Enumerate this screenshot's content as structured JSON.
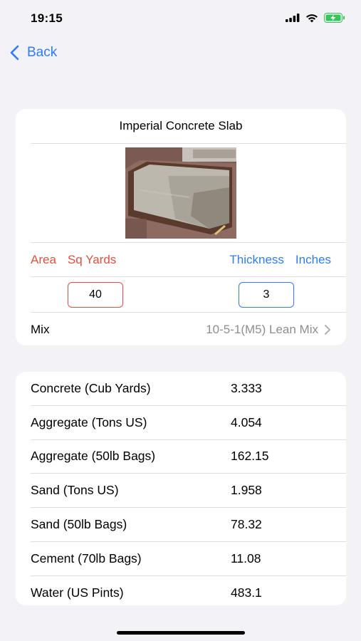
{
  "status": {
    "time": "19:15"
  },
  "nav": {
    "back_label": "Back"
  },
  "card": {
    "title": "Imperial Concrete Slab",
    "area_label": "Area",
    "area_unit": "Sq Yards",
    "thickness_label": "Thickness",
    "thickness_unit": "Inches",
    "area_value": "40",
    "thickness_value": "3",
    "mix_label": "Mix",
    "mix_value": "10-5-1(M5) Lean Mix"
  },
  "results": [
    {
      "label": "Concrete (Cub Yards)",
      "value": "3.333"
    },
    {
      "label": "Aggregate (Tons US)",
      "value": "4.054"
    },
    {
      "label": "Aggregate (50lb Bags)",
      "value": "162.15"
    },
    {
      "label": "Sand (Tons US)",
      "value": "1.958"
    },
    {
      "label": "Sand (50lb Bags)",
      "value": "78.32"
    },
    {
      "label": "Cement (70lb Bags)",
      "value": "11.08"
    },
    {
      "label": "Water (US Pints)",
      "value": "483.1"
    }
  ],
  "colors": {
    "accent_blue": "#2f7cf6",
    "accent_red": "#e2503d",
    "battery_green": "#34c759"
  }
}
